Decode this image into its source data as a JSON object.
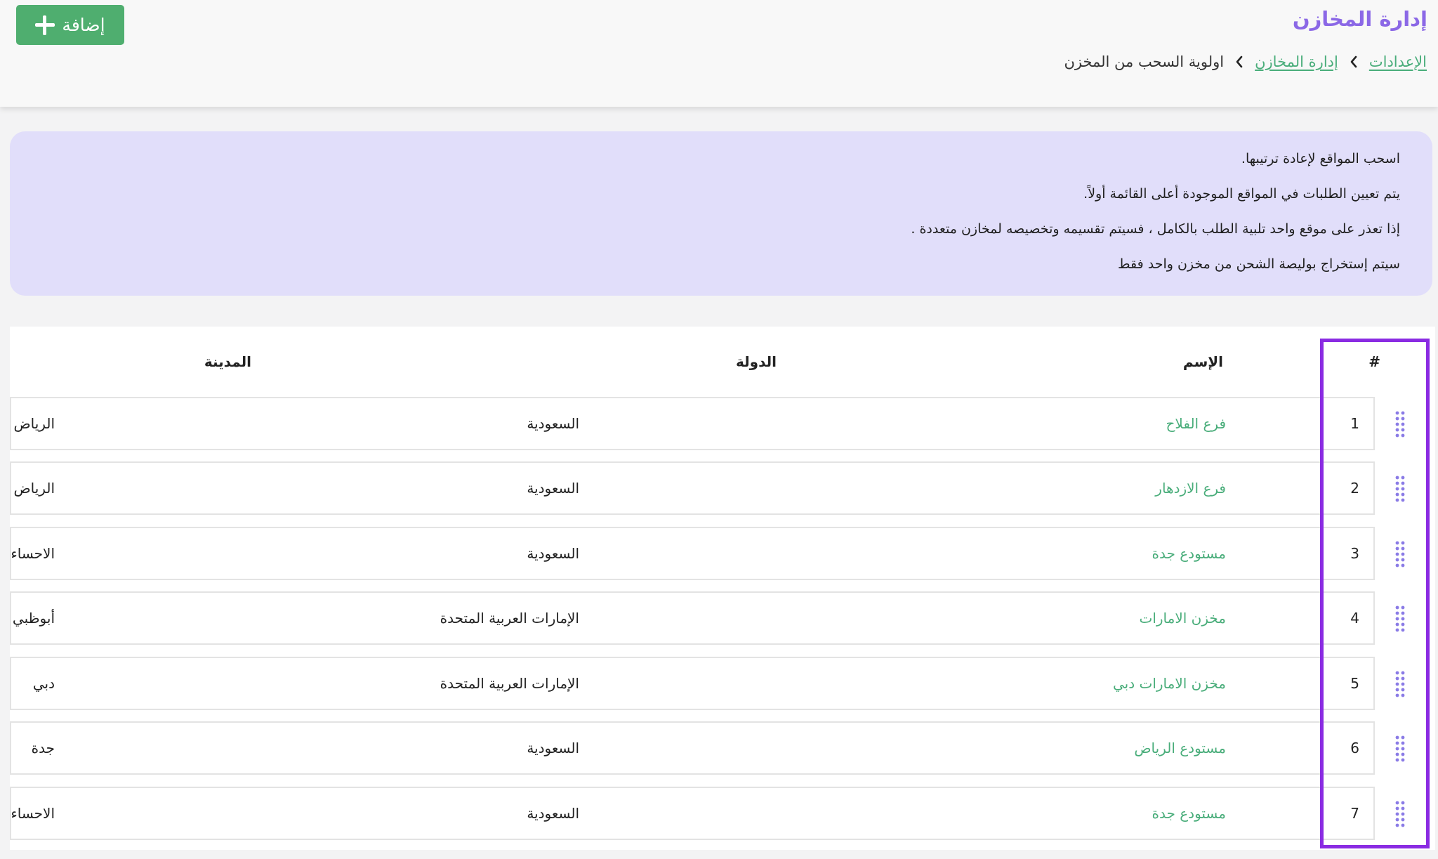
{
  "header": {
    "title": "إدارة المخازن",
    "add_button_label": "إضافة",
    "breadcrumb": {
      "settings": "الإعدادات",
      "warehouses": "إدارة المخازن",
      "current": "اولوية السحب من المخزن"
    }
  },
  "notice": {
    "lines": [
      "اسحب المواقع لإعادة ترتيبها.",
      "يتم تعيين الطلبات في المواقع الموجودة أعلى القائمة أولاً.",
      "إذا تعذر على موقع واحد تلبية الطلب بالكامل ، فسيتم تقسيمه وتخصيصه لمخازن متعددة .",
      "سيتم إستخراج بوليصة الشحن من مخزن واحد فقط"
    ]
  },
  "table": {
    "columns": {
      "index": "#",
      "name": "الإسم",
      "country": "الدولة",
      "city": "المدينة"
    },
    "rows": [
      {
        "index": "1",
        "name": "فرع الفلاح",
        "country": "السعودية",
        "city": "الرياض"
      },
      {
        "index": "2",
        "name": "فرع الازدهار",
        "country": "السعودية",
        "city": "الرياض"
      },
      {
        "index": "3",
        "name": "مستودع جدة",
        "country": "السعودية",
        "city": "الاحساء"
      },
      {
        "index": "4",
        "name": "مخزن الامارات",
        "country": "الإمارات العربية المتحدة",
        "city": "أبوظبي"
      },
      {
        "index": "5",
        "name": "مخزن الامارات دبي",
        "country": "الإمارات العربية المتحدة",
        "city": "دبي"
      },
      {
        "index": "6",
        "name": "مستودع الرياض",
        "country": "السعودية",
        "city": "جدة"
      },
      {
        "index": "7",
        "name": "مستودع جدة",
        "country": "السعودية",
        "city": "الاحساء"
      }
    ]
  },
  "colors": {
    "title": "#8b68e6",
    "link": "#49ad7a",
    "add_button": "#4fae6f",
    "notice_bg": "#e1defa",
    "drag_handle": "#8a7be6",
    "selection_border": "#8a2be2"
  },
  "icons": {
    "add": "plus-icon",
    "breadcrumb_separator": "chevron-left-icon",
    "drag": "drag-handle-icon"
  }
}
